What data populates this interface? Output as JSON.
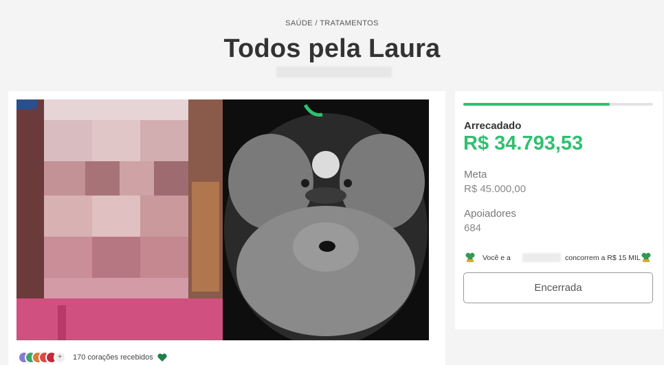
{
  "header": {
    "breadcrumb": "SAÚDE / TRATAMENTOS",
    "title": "Todos pela Laura"
  },
  "media": {
    "hearts_text": "170 corações recebidos",
    "avatar_extra": "+"
  },
  "stats": {
    "progress_fraction": 0.773,
    "raised_label": "Arrecadado",
    "raised_value": "R$ 34.793,53",
    "goal_label": "Meta",
    "goal_value": "R$ 45.000,00",
    "supporters_label": "Apoiadores",
    "supporters_value": "684",
    "promo_prefix": "Você e a",
    "promo_suffix": "concorrem a R$ 15 MIL",
    "closed_button": "Encerrada"
  },
  "colors": {
    "accent_green": "#2fc06f",
    "heart_green": "#1e7f4a"
  },
  "icons": {
    "heart": "heart-icon",
    "promo": "clover-icon"
  }
}
